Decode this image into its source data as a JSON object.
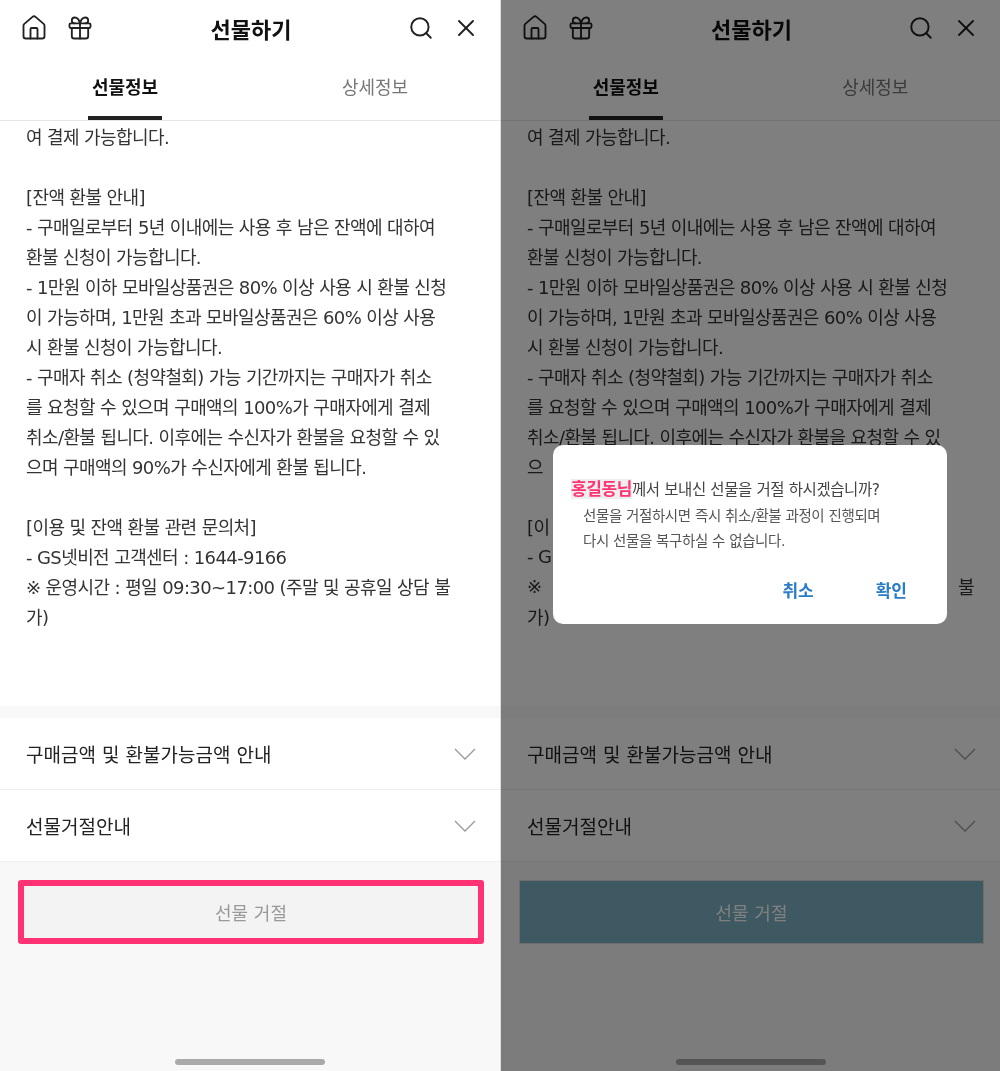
{
  "screens": [
    {
      "header": {
        "title": "선물하기"
      },
      "tabs": [
        {
          "label": "선물정보",
          "selected": true
        },
        {
          "label": "상세정보",
          "selected": false
        }
      ],
      "body_lines": [
        {
          "kind": "text",
          "text": "여 결제 가능합니다."
        },
        {
          "kind": "gap"
        },
        {
          "kind": "text",
          "text": "[잔액 환불 안내]"
        },
        {
          "kind": "text",
          "text": "- 구매일로부터 5년 이내에는 사용 후 남은 잔액에 대하여"
        },
        {
          "kind": "text",
          "text": "환불 신청이 가능합니다."
        },
        {
          "kind": "text",
          "text": "- 1만원 이하 모바일상품권은 80% 이상 사용 시 환불 신청"
        },
        {
          "kind": "text",
          "text": "이 가능하며, 1만원 초과 모바일상품권은 60% 이상 사용"
        },
        {
          "kind": "text",
          "text": "시 환불 신청이 가능합니다."
        },
        {
          "kind": "text",
          "text": "- 구매자 취소 (청약철회) 가능 기간까지는 구매자가 취소"
        },
        {
          "kind": "text",
          "text": "를 요청할 수 있으며 구매액의 100%가 구매자에게 결제"
        },
        {
          "kind": "text",
          "text": "취소/환불 됩니다. 이후에는 수신자가 환불을 요청할 수 있"
        },
        {
          "kind": "text",
          "text": "으며 구매액의 90%가 수신자에게 환불 됩니다."
        },
        {
          "kind": "gap"
        },
        {
          "kind": "text",
          "text": "[이용 및 잔액 환불 관련 문의처]"
        },
        {
          "kind": "text",
          "text": "- GS넷비전 고객센터 : 1644-9166"
        },
        {
          "kind": "text",
          "text": "※ 운영시간 : 평일 09:30~17:00 (주말 및 공휴일 상담 불"
        },
        {
          "kind": "text",
          "text": "가)"
        }
      ],
      "accordion": [
        {
          "label": "구매금액 및 환불가능금액 안내",
          "expanded": false
        },
        {
          "label": "선물거절안내",
          "expanded": false
        }
      ],
      "reject_button": {
        "label": "선물 거절",
        "highlighted": true,
        "pressed": false
      }
    },
    {
      "header": {
        "title": "선물하기"
      },
      "tabs": [
        {
          "label": "선물정보",
          "selected": true
        },
        {
          "label": "상세정보",
          "selected": false
        }
      ],
      "body_lines": [
        {
          "kind": "text",
          "text": "여 결제 가능합니다."
        },
        {
          "kind": "gap"
        },
        {
          "kind": "text",
          "text": "[잔액 환불 안내]"
        },
        {
          "kind": "text",
          "text": "- 구매일로부터 5년 이내에는 사용 후 남은 잔액에 대하여"
        },
        {
          "kind": "text",
          "text": "환불 신청이 가능합니다."
        },
        {
          "kind": "text",
          "text": "- 1만원 이하 모바일상품권은 80% 이상 사용 시 환불 신청"
        },
        {
          "kind": "text",
          "text": "이 가능하며, 1만원 초과 모바일상품권은 60% 이상 사용"
        },
        {
          "kind": "text",
          "text": "시 환불 신청이 가능합니다."
        },
        {
          "kind": "text",
          "text": "- 구매자 취소 (청약철회) 가능 기간까지는 구매자가 취소"
        },
        {
          "kind": "text",
          "text": "를 요청할 수 있으며 구매액의 100%가 구매자에게 결제"
        },
        {
          "kind": "text",
          "text": "취소/환불 됩니다. 이후에는 수신자가 환불을 요청할 수 있"
        },
        {
          "kind": "text",
          "text": "으"
        },
        {
          "kind": "gap"
        },
        {
          "kind": "text",
          "text": "[이"
        },
        {
          "kind": "text",
          "text": "- G"
        },
        {
          "kind": "text",
          "text": "※",
          "tail": "불"
        },
        {
          "kind": "text",
          "text": "가)"
        }
      ],
      "accordion": [
        {
          "label": "구매금액 및 환불가능금액 안내",
          "expanded": false
        },
        {
          "label": "선물거절안내",
          "expanded": false
        }
      ],
      "reject_button": {
        "label": "선물 거절",
        "highlighted": false,
        "pressed": true
      },
      "dialog": {
        "title": "**홍길동님**께서 보내신 선물을 거절 하시겠습니까?",
        "message_lines": [
          "선물을 거절하시면 즉시 취소/환불 과정이 진행되며",
          "다시 선물을 복구하실 수 없습니다."
        ],
        "buttons": [
          "취소",
          "확인"
        ]
      }
    }
  ]
}
